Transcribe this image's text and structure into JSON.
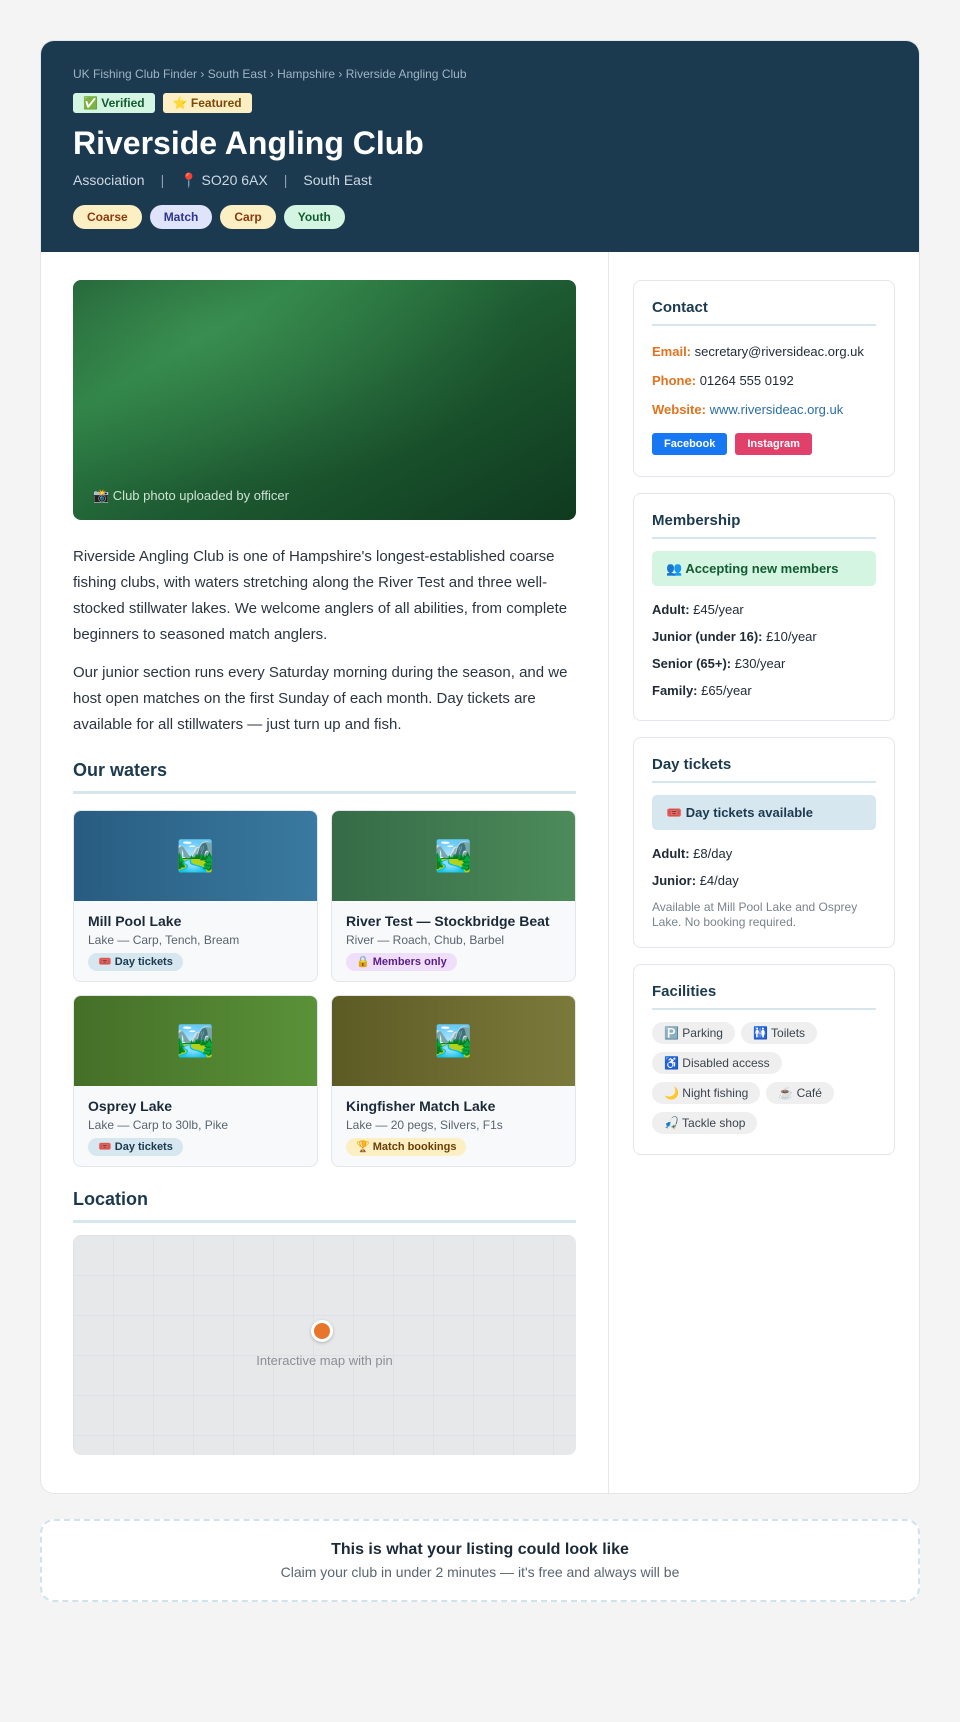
{
  "breadcrumb": "UK Fishing Club Finder › South East › Hampshire › Riverside Angling Club",
  "badges": {
    "verified": "✅ Verified",
    "featured": "⭐ Featured"
  },
  "club": {
    "name": "Riverside Angling Club",
    "type": "Association",
    "postcode": "📍 SO20 6AX",
    "region": "South East",
    "tags": [
      "Coarse",
      "Match",
      "Carp",
      "Youth"
    ]
  },
  "photo_caption": "📸 Club photo uploaded by officer",
  "description": [
    "Riverside Angling Club is one of Hampshire's longest-established coarse fishing clubs, with waters stretching along the River Test and three well-stocked stillwater lakes. We welcome anglers of all abilities, from complete beginners to seasoned match anglers.",
    "Our junior section runs every Saturday morning during the season, and we host open matches on the first Sunday of each month. Day tickets are available for all stillwaters — just turn up and fish."
  ],
  "waters_heading": "Our waters",
  "waters": [
    {
      "icon": "🏞️",
      "name": "Mill Pool Lake",
      "sub": "Lake — Carp, Tench, Bream",
      "tag": "🎟️ Day tickets"
    },
    {
      "icon": "🏞️",
      "name": "River Test — Stockbridge Beat",
      "sub": "River — Roach, Chub, Barbel",
      "tag": "🔒 Members only"
    },
    {
      "icon": "🏞️",
      "name": "Osprey Lake",
      "sub": "Lake — Carp to 30lb, Pike",
      "tag": "🎟️ Day tickets"
    },
    {
      "icon": "🏞️",
      "name": "Kingfisher Match Lake",
      "sub": "Lake — 20 pegs, Silvers, F1s",
      "tag": "🏆 Match bookings"
    }
  ],
  "location_heading": "Location",
  "map_label": "Interactive map with pin",
  "contact": {
    "heading": "Contact",
    "email_label": "Email:",
    "email": "secretary@riversideac.org.uk",
    "phone_label": "Phone:",
    "phone": "01264 555 0192",
    "website_label": "Website:",
    "website": "www.riversideac.org.uk",
    "facebook": "Facebook",
    "instagram": "Instagram"
  },
  "membership": {
    "heading": "Membership",
    "status": "👥 Accepting new members",
    "prices": [
      {
        "label": "Adult:",
        "value": "£45/year"
      },
      {
        "label": "Junior (under 16):",
        "value": "£10/year"
      },
      {
        "label": "Senior (65+):",
        "value": "£30/year"
      },
      {
        "label": "Family:",
        "value": "£65/year"
      }
    ]
  },
  "day_tickets": {
    "heading": "Day tickets",
    "status": "🎟️ Day tickets available",
    "prices": [
      {
        "label": "Adult:",
        "value": "£8/day"
      },
      {
        "label": "Junior:",
        "value": "£4/day"
      }
    ],
    "note": "Available at Mill Pool Lake and Osprey Lake. No booking required."
  },
  "facilities": {
    "heading": "Facilities",
    "items": [
      "🅿️ Parking",
      "🚻 Toilets",
      "♿ Disabled access",
      "🌙 Night fishing",
      "☕ Café",
      "🎣 Tackle shop"
    ]
  },
  "claim": {
    "title": "This is what your listing could look like",
    "subtitle": "Claim your club in under 2 minutes — it's free and always will be"
  },
  "colors": {
    "hero": "#1c3a4f",
    "accent": "#e0731f",
    "link": "#2a6da8"
  }
}
